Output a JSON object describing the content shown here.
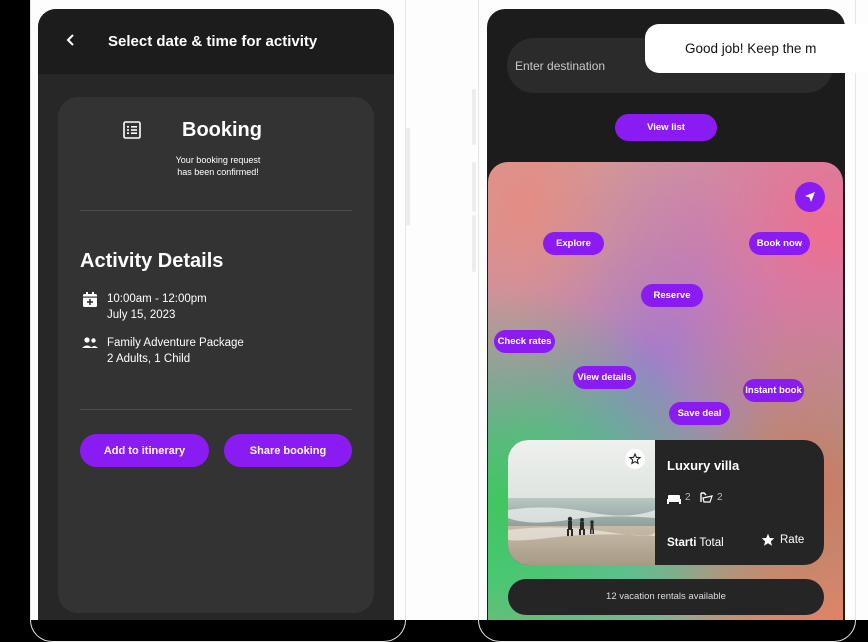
{
  "left_screen": {
    "header": {
      "title": "Select date & time for activity"
    },
    "booking": {
      "title": "Booking",
      "subtitle_line1": "Your booking request",
      "subtitle_line2": "has been confirmed!"
    },
    "details": {
      "title": "Activity Details",
      "time": "10:00am - 12:00pm",
      "date": "July 15, 2023",
      "package": "Family Adventure Package",
      "guests": "2 Adults, 1 Child"
    },
    "buttons": {
      "add_to_itinerary": "Add to itinerary",
      "share_booking": "Share booking"
    }
  },
  "right_screen": {
    "search": {
      "placeholder": "Enter destination"
    },
    "toast": "Good job! Keep the m",
    "view_list": "View list",
    "map_pins": {
      "explore": "Explore",
      "book_now": "Book now",
      "reserve": "Reserve",
      "check_rates": "Check rates",
      "view_details": "View details",
      "instant_book": "Instant book",
      "save_deal": "Save deal"
    },
    "listing": {
      "title": "Luxury villa",
      "beds": "2",
      "baths": "2",
      "price_bold": "Starti",
      "price_rest": " Total",
      "rate_label": "Rate"
    },
    "rentals_count": "12 vacation rentals available"
  },
  "colors": {
    "accent": "#8a1cf3",
    "card": "#333333",
    "background": "#272727"
  }
}
